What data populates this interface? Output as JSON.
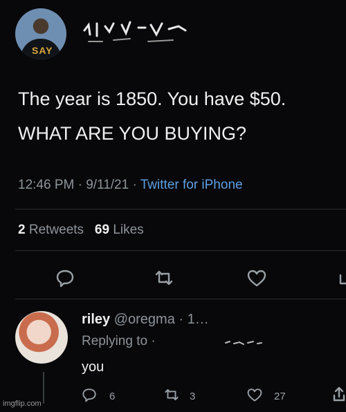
{
  "tweet": {
    "avatar_shirt_text": "SAY",
    "line1": "The year is 1850. You have $50.",
    "line2": "WHAT ARE YOU BUYING?",
    "timestamp": "12:46 PM · 9/11/21 · ",
    "source": "Twitter for iPhone",
    "retweet_count": "2",
    "retweet_label": "Retweets",
    "like_count": "69",
    "like_label": "Likes"
  },
  "actions": {
    "reply_icon": "reply-icon",
    "retweet_icon": "retweet-icon",
    "like_icon": "heart-icon",
    "share_icon": "share-icon"
  },
  "reply": {
    "name": "riley",
    "handle": "@oregma · 1…",
    "replying_to": "Replying to ·",
    "text": "you",
    "reply_count": "6",
    "retweet_count": "3",
    "like_count": "27"
  },
  "watermark": "imgflip.com",
  "colors": {
    "background": "#08080a",
    "link": "#5f9fe2",
    "secondary_text": "#8d949a"
  }
}
